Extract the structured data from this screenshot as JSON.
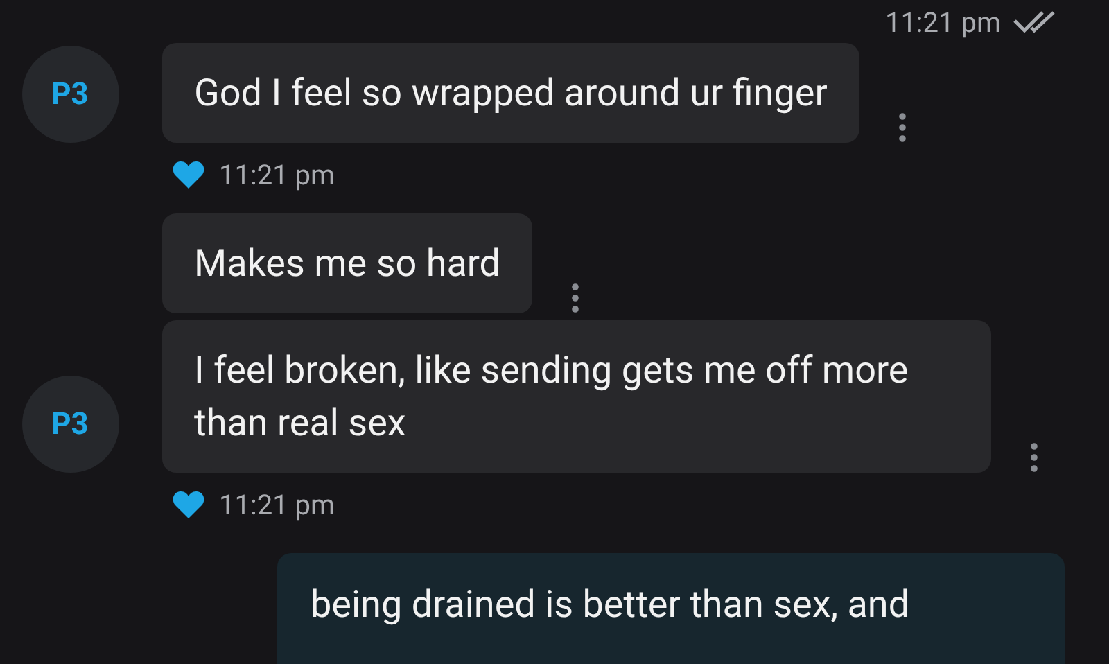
{
  "top_status": {
    "time": "11:21 pm",
    "read": true
  },
  "messages": [
    {
      "kind": "incoming",
      "avatar": "P3",
      "text": "God I feel so wrapped around ur finger",
      "liked": true,
      "time": "11:21 pm"
    },
    {
      "kind": "incoming",
      "text": "Makes me so hard"
    },
    {
      "kind": "incoming",
      "avatar": "P3",
      "text": "I feel broken, like sending gets me off more than real sex",
      "liked": true,
      "time": "11:21 pm"
    },
    {
      "kind": "outgoing",
      "text": "being drained is better than sex, and"
    }
  ]
}
